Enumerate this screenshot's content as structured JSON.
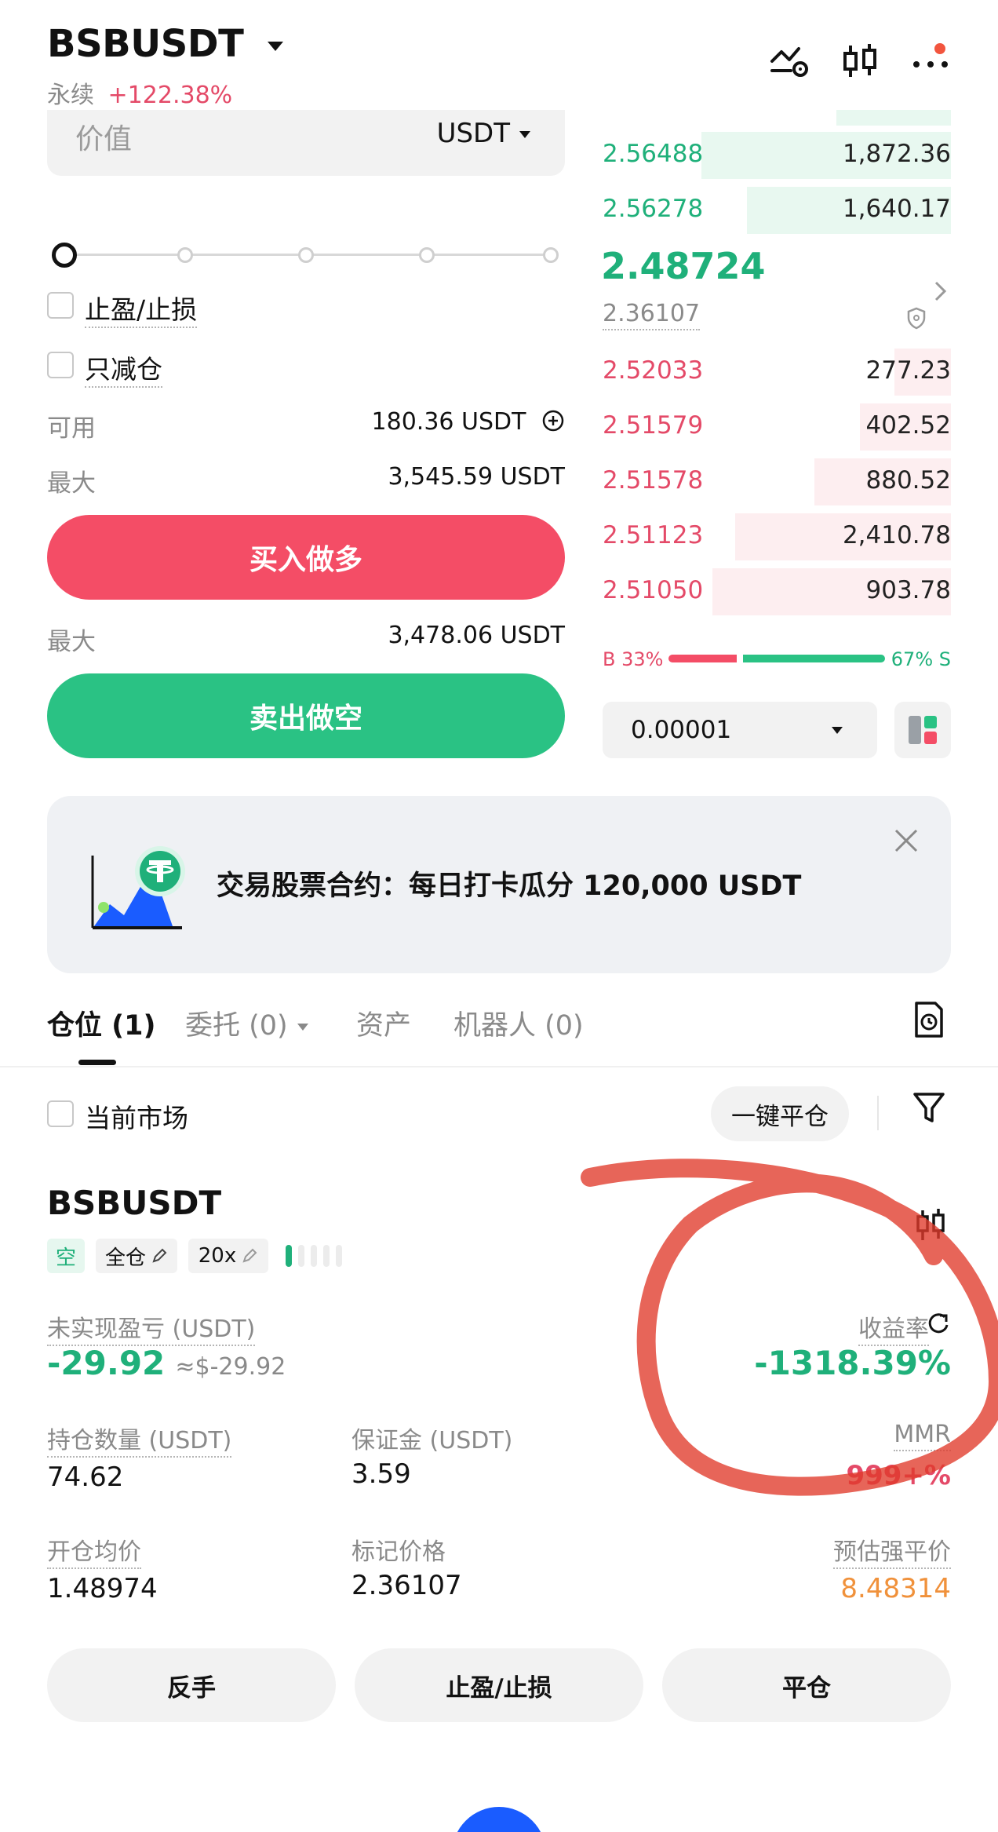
{
  "header": {
    "pair": "BSBUSDT",
    "contract_type": "永续",
    "change": "+122.38%"
  },
  "order_form": {
    "value_placeholder": "价值",
    "value_unit": "USDT",
    "tp_sl_label": "止盈/止损",
    "reduce_only_label": "只减仓",
    "available_label": "可用",
    "available_value": "180.36 USDT",
    "max_label_buy": "最大",
    "max_value_buy": "3,545.59 USDT",
    "buy_button": "买入做多",
    "max_label_sell": "最大",
    "max_value_sell": "3,478.06 USDT",
    "sell_button": "卖出做空"
  },
  "order_book": {
    "asks": [
      {
        "price": "2.56488",
        "qty": "1,872.36",
        "depth": 0.22
      },
      {
        "price": "2.56278",
        "qty": "1,640.17",
        "depth": 0.18
      }
    ],
    "last_price": "2.48724",
    "mark_price": "2.36107",
    "bids": [
      {
        "price": "2.52033",
        "qty": "277.23",
        "depth": 0.05
      },
      {
        "price": "2.51579",
        "qty": "402.52",
        "depth": 0.08
      },
      {
        "price": "2.51578",
        "qty": "880.52",
        "depth": 0.12
      },
      {
        "price": "2.51123",
        "qty": "2,410.78",
        "depth": 0.19
      },
      {
        "price": "2.51050",
        "qty": "903.78",
        "depth": 0.21
      }
    ],
    "buy_ratio_label": "B 33%",
    "sell_ratio_label": "67% S",
    "buy_ratio": 0.33,
    "precision": "0.00001"
  },
  "banner": {
    "text": "交易股票合约：每日打卡瓜分 120,000 USDT"
  },
  "tabs": [
    {
      "label": "仓位 (1)"
    },
    {
      "label": "委托 (0)"
    },
    {
      "label": "资产"
    },
    {
      "label": "机器人 (0)"
    }
  ],
  "position_filters": {
    "current_market": "当前市场",
    "close_all": "一键平仓"
  },
  "position": {
    "symbol": "BSBUSDT",
    "side": "空",
    "margin_mode": "全仓",
    "leverage": "20x",
    "unrealized_pnl_label": "未实现盈亏 (USDT)",
    "unrealized_pnl": "-29.92",
    "unrealized_pnl_usd": "≈$-29.92",
    "roe_label": "收益率",
    "roe": "-1318.39%",
    "size_label": "持仓数量 (USDT)",
    "size": "74.62",
    "margin_label": "保证金 (USDT)",
    "margin": "3.59",
    "mmr_label": "MMR",
    "mmr": "999+%",
    "entry_label": "开仓均价",
    "entry": "1.48974",
    "mark_label": "标记价格",
    "mark": "2.36107",
    "liq_label": "预估强平价",
    "liq": "8.48314"
  },
  "actions": {
    "reverse": "反手",
    "tp_sl": "止盈/止损",
    "close": "平仓"
  },
  "colors": {
    "green": "#2ac284",
    "red": "#f44d66",
    "annotation": "#e03a2a"
  }
}
